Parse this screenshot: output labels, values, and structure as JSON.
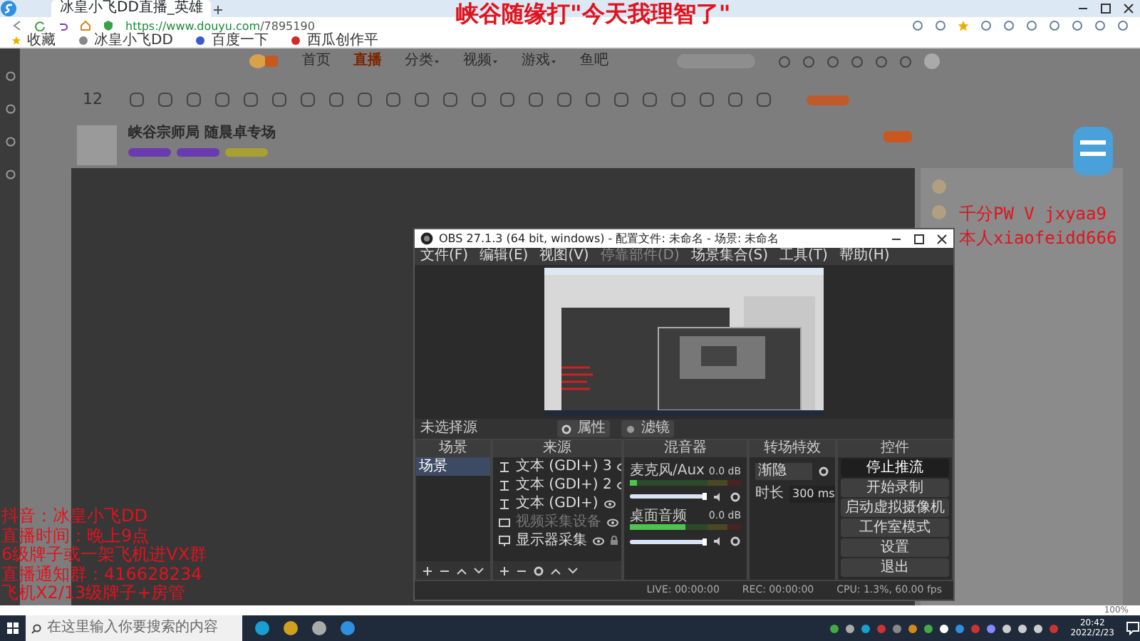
{
  "browser": {
    "tab_title": "冰皇小飞DD直播_英雄",
    "url_host": "https://www.douyu.com",
    "url_path": "/7895190",
    "bookmarks": [
      "收藏",
      "冰皇小飞DD",
      "百度一下",
      "西瓜创作平"
    ],
    "zoom": "100%"
  },
  "page": {
    "nav": [
      {
        "label": "首页",
        "selected": false,
        "dropdown": false
      },
      {
        "label": "直播",
        "selected": true,
        "dropdown": false
      },
      {
        "label": "分类",
        "selected": false,
        "dropdown": true
      },
      {
        "label": "视频",
        "selected": false,
        "dropdown": true
      },
      {
        "label": "游戏",
        "selected": false,
        "dropdown": true
      },
      {
        "label": "鱼吧",
        "selected": false,
        "dropdown": false
      }
    ],
    "follow_count": "12",
    "room_title": "峡谷宗师局 随晨卓专场"
  },
  "overlay": {
    "headline": "峡谷随缘打\"今天我理智了\"",
    "right_lines": [
      "千分PW V jxyaa9",
      "本人xiaofeidd666"
    ],
    "left_lines": [
      "抖音：冰皇小飞DD",
      "直播时间：晚上9点",
      "6级牌子或一架飞机进VX群",
      "直播通知群：416628234",
      "飞机X2/13级牌子+房管"
    ]
  },
  "obs": {
    "title": "OBS 27.1.3 (64 bit, windows) - 配置文件: 未命名 - 场景: 未命名",
    "menu": [
      {
        "label": "文件(F)",
        "disabled": false
      },
      {
        "label": "编辑(E)",
        "disabled": false
      },
      {
        "label": "视图(V)",
        "disabled": false
      },
      {
        "label": "停靠部件(D)",
        "disabled": true
      },
      {
        "label": "场景集合(S)",
        "disabled": false
      },
      {
        "label": "工具(T)",
        "disabled": false
      },
      {
        "label": "帮助(H)",
        "disabled": false
      }
    ],
    "no_source": "未选择源",
    "properties": "属性",
    "filters": "滤镜",
    "docks": [
      "场景",
      "来源",
      "混音器",
      "转场特效",
      "控件"
    ],
    "scenes": [
      {
        "label": "场景",
        "selected": true
      }
    ],
    "sources": [
      {
        "label": "文本 (GDI+) 3",
        "kind": "text",
        "disabled": false
      },
      {
        "label": "文本 (GDI+) 2",
        "kind": "text",
        "disabled": false
      },
      {
        "label": "文本 (GDI+)",
        "kind": "text",
        "disabled": false
      },
      {
        "label": "视频采集设备",
        "kind": "camera",
        "disabled": true
      },
      {
        "label": "显示器采集",
        "kind": "display",
        "disabled": false
      }
    ],
    "mixer": [
      {
        "name": "麦克风/Aux",
        "reading": "0.0 dB",
        "meter": {
          "level": 0.06
        },
        "fader": {
          "level": 1
        }
      },
      {
        "name": "桌面音频",
        "reading": "0.0 dB",
        "meter": {
          "level": 0.5
        },
        "fader": {
          "level": 1
        }
      }
    ],
    "transition": {
      "type": "渐隐",
      "duration_label": "时长",
      "duration": "300 ms"
    },
    "controls": [
      {
        "label": "停止推流",
        "active": true
      },
      {
        "label": "开始录制",
        "active": false
      },
      {
        "label": "启动虚拟摄像机",
        "active": false
      },
      {
        "label": "工作室模式",
        "active": false
      },
      {
        "label": "设置",
        "active": false
      },
      {
        "label": "退出",
        "active": false
      }
    ],
    "status": {
      "live": "LIVE: 00:00:00",
      "rec": "REC: 00:00:00",
      "cpu": "CPU: 1.3%, 60.00 fps"
    }
  },
  "taskbar": {
    "search_placeholder": "在这里输入你要搜索的内容",
    "time": "20:42",
    "date": "2022/2/23"
  }
}
